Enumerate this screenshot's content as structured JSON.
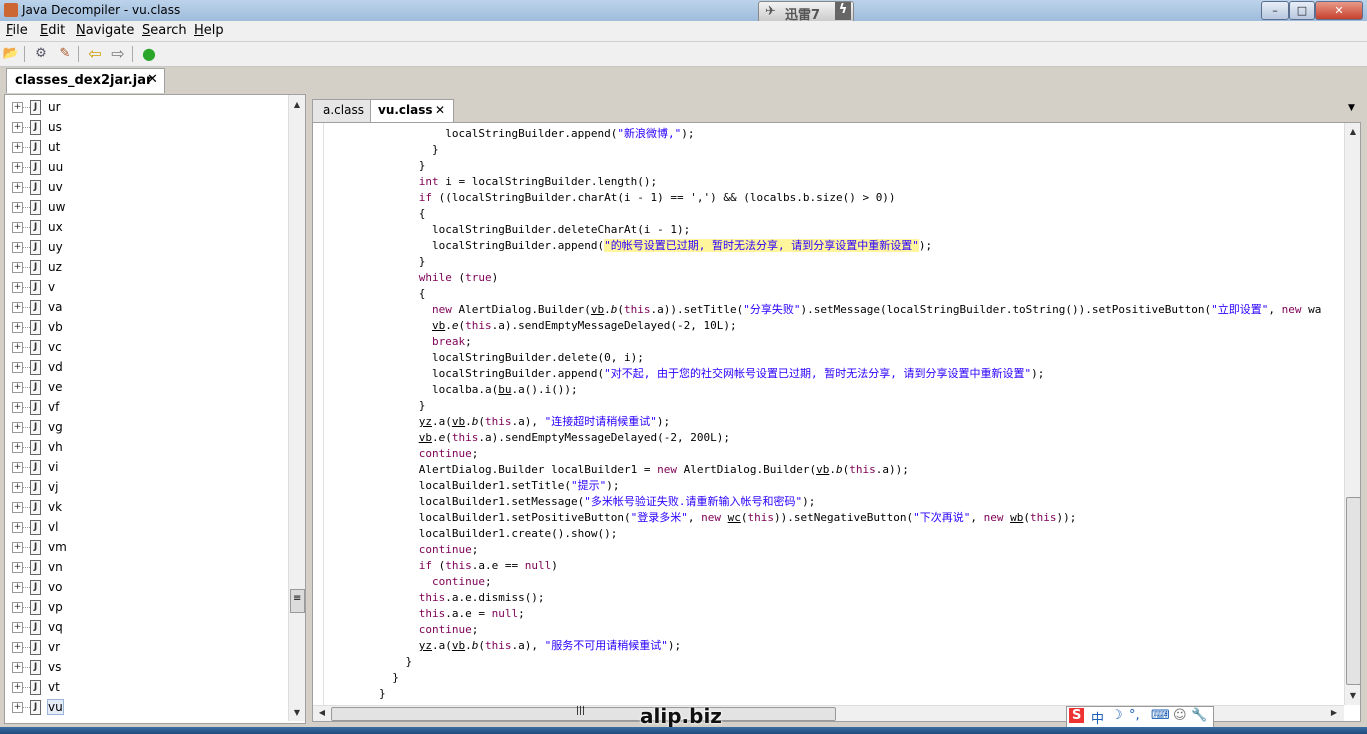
{
  "window": {
    "title": "Java Decompiler - vu.class",
    "thunder_label": "迅雷7",
    "minimize": "–",
    "maximize": "□",
    "close": "✕"
  },
  "menu": {
    "items": [
      {
        "label": "File",
        "accel": "F",
        "rest": "ile"
      },
      {
        "label": "Edit",
        "accel": "E",
        "rest": "dit"
      },
      {
        "label": "Navigate",
        "accel": "N",
        "rest": "avigate"
      },
      {
        "label": "Search",
        "accel": "S",
        "rest": "earch"
      },
      {
        "label": "Help",
        "accel": "H",
        "rest": "elp"
      }
    ]
  },
  "toolbar": {
    "icons": [
      "open-file-icon",
      "open-type-icon",
      "search-icon",
      "back-arrow-icon",
      "forward-arrow-icon",
      "run-icon"
    ],
    "glyphs": [
      "📂",
      "⚙",
      "✎",
      "⇦",
      "⇨",
      "●"
    ]
  },
  "left_panel": {
    "tab_label": "classes_dex2jar.jar",
    "tab_close": "✕",
    "tree_items": [
      {
        "label": "ur"
      },
      {
        "label": "us"
      },
      {
        "label": "ut"
      },
      {
        "label": "uu"
      },
      {
        "label": "uv"
      },
      {
        "label": "uw"
      },
      {
        "label": "ux"
      },
      {
        "label": "uy"
      },
      {
        "label": "uz"
      },
      {
        "label": "v"
      },
      {
        "label": "va"
      },
      {
        "label": "vb"
      },
      {
        "label": "vc"
      },
      {
        "label": "vd"
      },
      {
        "label": "ve"
      },
      {
        "label": "vf"
      },
      {
        "label": "vg"
      },
      {
        "label": "vh"
      },
      {
        "label": "vi"
      },
      {
        "label": "vj"
      },
      {
        "label": "vk"
      },
      {
        "label": "vl"
      },
      {
        "label": "vm"
      },
      {
        "label": "vn"
      },
      {
        "label": "vo"
      },
      {
        "label": "vp"
      },
      {
        "label": "vq"
      },
      {
        "label": "vr"
      },
      {
        "label": "vs"
      },
      {
        "label": "vt"
      },
      {
        "label": "vu"
      }
    ],
    "selected": "vu"
  },
  "editor": {
    "tabs": [
      {
        "label": "a.class",
        "active": false
      },
      {
        "label": "vu.class",
        "active": true,
        "close": "✕"
      }
    ],
    "menu_arrow": "▼"
  },
  "code_lines": [
    {
      "indent": 10,
      "parts": [
        [
          "",
          "localStringBuilder.append("
        ],
        [
          "str",
          "\"新浪微博,\""
        ],
        [
          "",
          ");"
        ]
      ]
    },
    {
      "indent": 8,
      "parts": [
        [
          "",
          "}"
        ]
      ]
    },
    {
      "indent": 6,
      "parts": [
        [
          "",
          "}"
        ]
      ]
    },
    {
      "indent": 6,
      "parts": [
        [
          "kw",
          "int"
        ],
        [
          "",
          " i = localStringBuilder.length();"
        ]
      ]
    },
    {
      "indent": 6,
      "parts": [
        [
          "kw",
          "if"
        ],
        [
          "",
          " ((localStringBuilder.charAt(i - 1) == ','"
        ],
        [
          "",
          ") && (localbs.b.size() > 0))"
        ]
      ]
    },
    {
      "indent": 6,
      "parts": [
        [
          "",
          "{"
        ]
      ]
    },
    {
      "indent": 8,
      "parts": [
        [
          "",
          "localStringBuilder.deleteCharAt(i - 1);"
        ]
      ]
    },
    {
      "indent": 8,
      "parts": [
        [
          "",
          "localStringBuilder.append("
        ],
        [
          "str hl",
          "\"的帐号设置已过期, 暂时无法分享, 请到分享设置中重新设置\""
        ],
        [
          "",
          ");"
        ]
      ]
    },
    {
      "indent": 6,
      "parts": [
        [
          "",
          "}"
        ]
      ]
    },
    {
      "indent": 6,
      "parts": [
        [
          "kw",
          "while"
        ],
        [
          "",
          " ("
        ],
        [
          "kw",
          "true"
        ],
        [
          "",
          ")"
        ]
      ]
    },
    {
      "indent": 6,
      "parts": [
        [
          "",
          "{"
        ]
      ]
    },
    {
      "indent": 8,
      "parts": [
        [
          "kw",
          "new"
        ],
        [
          "",
          " AlertDialog.Builder("
        ],
        [
          "udl",
          "vb"
        ],
        [
          "",
          "."
        ],
        [
          "it",
          "b"
        ],
        [
          "",
          "("
        ],
        [
          "kw",
          "this"
        ],
        [
          "",
          ".a)).setTitle("
        ],
        [
          "str",
          "\"分享失败\""
        ],
        [
          "",
          ").setMessage(localStringBuilder.toString()).setPositiveButton("
        ],
        [
          "str",
          "\"立即设置\""
        ],
        [
          "",
          ", "
        ],
        [
          "kw",
          "new"
        ],
        [
          "",
          " wa"
        ]
      ]
    },
    {
      "indent": 8,
      "parts": [
        [
          "udl",
          "vb"
        ],
        [
          "",
          "."
        ],
        [
          "it",
          "e"
        ],
        [
          "",
          "("
        ],
        [
          "kw",
          "this"
        ],
        [
          "",
          ".a).sendEmptyMessageDelayed(-2, 10L);"
        ]
      ]
    },
    {
      "indent": 8,
      "parts": [
        [
          "kw",
          "break"
        ],
        [
          "",
          ";"
        ]
      ]
    },
    {
      "indent": 8,
      "parts": [
        [
          "",
          "localStringBuilder.delete(0, i);"
        ]
      ]
    },
    {
      "indent": 8,
      "parts": [
        [
          "",
          "localStringBuilder.append("
        ],
        [
          "str",
          "\"对不起, 由于您的社交网帐号设置已过期, 暂时无法分享, 请到分享设置中重新设置\""
        ],
        [
          "",
          ");"
        ]
      ]
    },
    {
      "indent": 8,
      "parts": [
        [
          "",
          "localba.a("
        ],
        [
          "udl",
          "bu"
        ],
        [
          "",
          ".a().i());"
        ]
      ]
    },
    {
      "indent": 6,
      "parts": [
        [
          "",
          "}"
        ]
      ]
    },
    {
      "indent": 6,
      "parts": [
        [
          "udl",
          "yz"
        ],
        [
          "",
          ".a("
        ],
        [
          "udl",
          "vb"
        ],
        [
          "",
          "."
        ],
        [
          "it",
          "b"
        ],
        [
          "",
          "("
        ],
        [
          "kw",
          "this"
        ],
        [
          "",
          ".a), "
        ],
        [
          "str",
          "\"连接超时请稍候重试\""
        ],
        [
          "",
          ");"
        ]
      ]
    },
    {
      "indent": 6,
      "parts": [
        [
          "udl",
          "vb"
        ],
        [
          "",
          "."
        ],
        [
          "it",
          "e"
        ],
        [
          "",
          "("
        ],
        [
          "kw",
          "this"
        ],
        [
          "",
          ".a).sendEmptyMessageDelayed(-2, 200L);"
        ]
      ]
    },
    {
      "indent": 6,
      "parts": [
        [
          "kw",
          "continue"
        ],
        [
          "",
          ";"
        ]
      ]
    },
    {
      "indent": 6,
      "parts": [
        [
          "",
          "AlertDialog.Builder localBuilder1 = "
        ],
        [
          "kw",
          "new"
        ],
        [
          "",
          " AlertDialog.Builder("
        ],
        [
          "udl",
          "vb"
        ],
        [
          "",
          "."
        ],
        [
          "it",
          "b"
        ],
        [
          "",
          "("
        ],
        [
          "kw",
          "this"
        ],
        [
          "",
          ".a));"
        ]
      ]
    },
    {
      "indent": 6,
      "parts": [
        [
          "",
          "localBuilder1.setTitle("
        ],
        [
          "str",
          "\"提示\""
        ],
        [
          "",
          ");"
        ]
      ]
    },
    {
      "indent": 6,
      "parts": [
        [
          "",
          "localBuilder1.setMessage("
        ],
        [
          "str",
          "\"多米帐号验证失败.请重新输入帐号和密码\""
        ],
        [
          "",
          ");"
        ]
      ]
    },
    {
      "indent": 6,
      "parts": [
        [
          "",
          "localBuilder1.setPositiveButton("
        ],
        [
          "str",
          "\"登录多米\""
        ],
        [
          "",
          ", "
        ],
        [
          "kw",
          "new"
        ],
        [
          "",
          " "
        ],
        [
          "udl",
          "wc"
        ],
        [
          "",
          "("
        ],
        [
          "kw",
          "this"
        ],
        [
          "",
          ")).setNegativeButton("
        ],
        [
          "str",
          "\"下次再说\""
        ],
        [
          "",
          ", "
        ],
        [
          "kw",
          "new"
        ],
        [
          "",
          " "
        ],
        [
          "udl",
          "wb"
        ],
        [
          "",
          "("
        ],
        [
          "kw",
          "this"
        ],
        [
          "",
          "));"
        ]
      ]
    },
    {
      "indent": 6,
      "parts": [
        [
          "",
          "localBuilder1.create().show();"
        ]
      ]
    },
    {
      "indent": 6,
      "parts": [
        [
          "kw",
          "continue"
        ],
        [
          "",
          ";"
        ]
      ]
    },
    {
      "indent": 6,
      "parts": [
        [
          "kw",
          "if"
        ],
        [
          "",
          " ("
        ],
        [
          "kw",
          "this"
        ],
        [
          "",
          ".a.e == "
        ],
        [
          "kw",
          "null"
        ],
        [
          "",
          ")"
        ]
      ]
    },
    {
      "indent": 8,
      "parts": [
        [
          "kw",
          "continue"
        ],
        [
          "",
          ";"
        ]
      ]
    },
    {
      "indent": 6,
      "parts": [
        [
          "kw",
          "this"
        ],
        [
          "",
          ".a.e.dismiss();"
        ]
      ]
    },
    {
      "indent": 6,
      "parts": [
        [
          "kw",
          "this"
        ],
        [
          "",
          ".a.e = "
        ],
        [
          "kw",
          "null"
        ],
        [
          "",
          ";"
        ]
      ]
    },
    {
      "indent": 6,
      "parts": [
        [
          "kw",
          "continue"
        ],
        [
          "",
          ";"
        ]
      ]
    },
    {
      "indent": 6,
      "parts": [
        [
          "udl",
          "yz"
        ],
        [
          "",
          ".a("
        ],
        [
          "udl",
          "vb"
        ],
        [
          "",
          "."
        ],
        [
          "it",
          "b"
        ],
        [
          "",
          "("
        ],
        [
          "kw",
          "this"
        ],
        [
          "",
          ".a), "
        ],
        [
          "str",
          "\"服务不可用请稍候重试\""
        ],
        [
          "",
          ");"
        ]
      ]
    },
    {
      "indent": 4,
      "parts": [
        [
          "",
          "}"
        ]
      ]
    },
    {
      "indent": 2,
      "parts": [
        [
          "",
          "}"
        ]
      ]
    },
    {
      "indent": 0,
      "parts": [
        [
          "",
          "}"
        ]
      ]
    }
  ],
  "watermark": "alip.biz",
  "ime": {
    "items": [
      "S",
      "中",
      "☽",
      "°,",
      "⌨",
      "☺",
      "🔧"
    ]
  },
  "scrollbars": {
    "up": "▲",
    "down": "▼",
    "left": "◀",
    "right": "▶",
    "grip": "≡",
    "hgrip": "|||"
  }
}
